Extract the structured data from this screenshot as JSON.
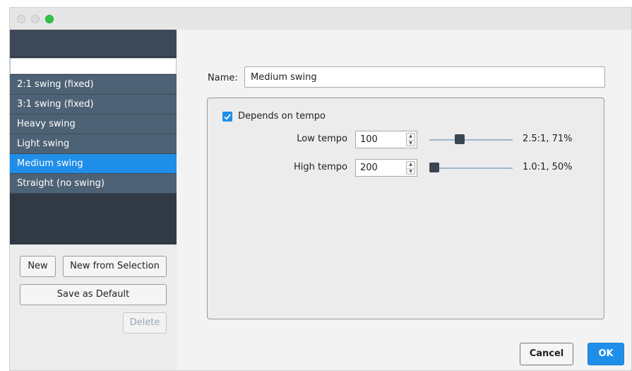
{
  "sidebar": {
    "search_value": "",
    "presets": [
      {
        "label": "2:1 swing (fixed)",
        "selected": false
      },
      {
        "label": "3:1 swing (fixed)",
        "selected": false
      },
      {
        "label": "Heavy swing",
        "selected": false
      },
      {
        "label": "Light swing",
        "selected": false
      },
      {
        "label": "Medium swing",
        "selected": true
      },
      {
        "label": "Straight (no swing)",
        "selected": false
      }
    ],
    "buttons": {
      "new": "New",
      "new_from_selection": "New from Selection",
      "save_as_default": "Save as Default",
      "delete": "Delete"
    }
  },
  "editor": {
    "name_label": "Name:",
    "name_value": "Medium swing",
    "depends_on_tempo": {
      "label": "Depends on tempo",
      "checked": true
    },
    "low_tempo": {
      "label": "Low tempo",
      "value": "100",
      "slider_fraction": 0.35,
      "ratio": "2.5:1,  71%"
    },
    "high_tempo": {
      "label": "High tempo",
      "value": "200",
      "slider_fraction": 0.0,
      "ratio": "1.0:1,  50%"
    }
  },
  "footer": {
    "cancel": "Cancel",
    "ok": "OK"
  },
  "colors": {
    "accent": "#1f8ee9",
    "list_bg": "#4e6275",
    "list_dark": "#2f3a45",
    "traffic_green": "#2ec54a"
  },
  "icons": [
    "close-dot-icon",
    "minimize-dot-icon",
    "zoom-dot-icon",
    "checkmark-icon",
    "stepper-up-icon",
    "stepper-down-icon"
  ]
}
